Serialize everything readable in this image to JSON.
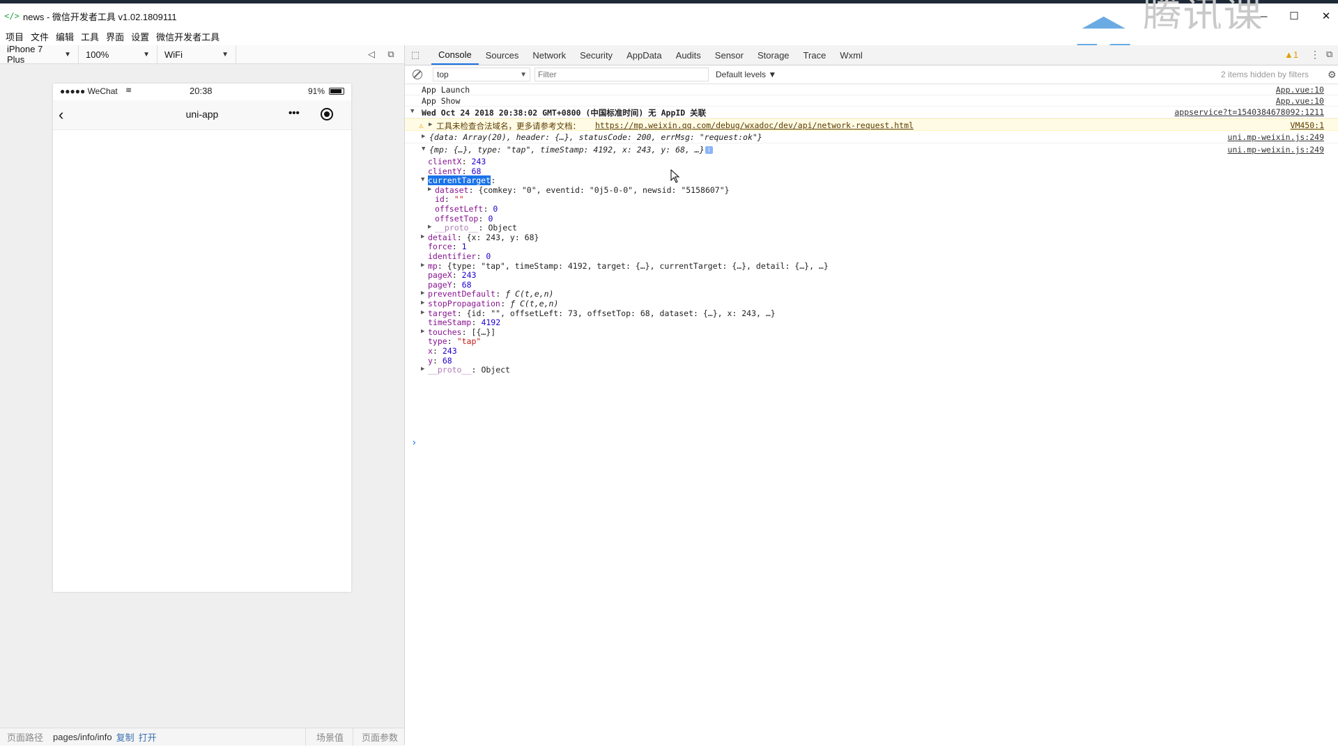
{
  "window": {
    "title": "news - 微信开发者工具 v1.02.1809111"
  },
  "menu": [
    "项目",
    "文件",
    "编辑",
    "工具",
    "界面",
    "设置",
    "微信开发者工具"
  ],
  "simulator": {
    "device": "iPhone 7 Plus",
    "zoom": "100%",
    "network": "WiFi",
    "status_carrier": "●●●●● WeChat",
    "status_time": "20:38",
    "status_battery": "91%",
    "battery_level": 0.91,
    "nav_title": "uni-app",
    "nav_more": "•••"
  },
  "bottom": {
    "path_label": "页面路径",
    "path": "pages/info/info",
    "copy": "复制",
    "open": "打开",
    "scene": "场景值",
    "params": "页面参数"
  },
  "devtools": {
    "tabs": [
      "Console",
      "Sources",
      "Network",
      "Security",
      "AppData",
      "Audits",
      "Sensor",
      "Storage",
      "Trace",
      "Wxml"
    ],
    "context": "top",
    "filter_placeholder": "Filter",
    "levels": "Default levels ▼",
    "hidden": "2 items hidden by filters"
  },
  "console": {
    "launch": "App Launch",
    "launch_src": "App.vue:10",
    "show": "App Show",
    "show_src": "App.vue:10",
    "date": "Wed Oct 24 2018 20:38:02 GMT+0800 (中国标准时间) 无 AppID 关联",
    "date_src": "appservice?t=1540384678092:1211",
    "warn_text": "工具未检查合法域名，更多请参考文档：",
    "warn_link": "https://mp.weixin.qq.com/debug/wxadoc/dev/api/network-request.html",
    "warn_src": "VM450:1",
    "resp_line": "{data: Array(20), header: {…}, statusCode: 200, errMsg: \"request:ok\"}",
    "resp_src": "uni.mp-weixin.js:249",
    "event_line": "{mp: {…}, type: \"tap\", timeStamp: 4192, x: 243, y: 68, …}",
    "event_src": "uni.mp-weixin.js:249",
    "props": [
      {
        "k": "clientX",
        "v": "243",
        "t": "num",
        "indent": 1,
        "exp": ""
      },
      {
        "k": "clientY",
        "v": "68",
        "t": "num",
        "indent": 1,
        "exp": ""
      },
      {
        "k": "currentTarget",
        "v": "",
        "t": "sel",
        "indent": 1,
        "exp": "open"
      },
      {
        "k": "dataset",
        "v": "{comkey: \"0\", eventid: \"0j5-0-0\", newsid: \"5158607\"}",
        "t": "obj",
        "indent": 2,
        "exp": "closed"
      },
      {
        "k": "id",
        "v": "\"\"",
        "t": "str",
        "indent": 2,
        "exp": ""
      },
      {
        "k": "offsetLeft",
        "v": "0",
        "t": "num",
        "indent": 2,
        "exp": ""
      },
      {
        "k": "offsetTop",
        "v": "0",
        "t": "num",
        "indent": 2,
        "exp": ""
      },
      {
        "k": "__proto__",
        "v": "Object",
        "t": "plain",
        "indent": 2,
        "exp": "closed"
      },
      {
        "k": "detail",
        "v": "{x: 243, y: 68}",
        "t": "obj",
        "indent": 1,
        "exp": "closed"
      },
      {
        "k": "force",
        "v": "1",
        "t": "num",
        "indent": 1,
        "exp": ""
      },
      {
        "k": "identifier",
        "v": "0",
        "t": "num",
        "indent": 1,
        "exp": ""
      },
      {
        "k": "mp",
        "v": "{type: \"tap\", timeStamp: 4192, target: {…}, currentTarget: {…}, detail: {…}, …}",
        "t": "obj",
        "indent": 1,
        "exp": "closed"
      },
      {
        "k": "pageX",
        "v": "243",
        "t": "num",
        "indent": 1,
        "exp": ""
      },
      {
        "k": "pageY",
        "v": "68",
        "t": "num",
        "indent": 1,
        "exp": ""
      },
      {
        "k": "preventDefault",
        "v": "ƒ C(t,e,n)",
        "t": "fn",
        "indent": 1,
        "exp": "closed"
      },
      {
        "k": "stopPropagation",
        "v": "ƒ C(t,e,n)",
        "t": "fn",
        "indent": 1,
        "exp": "closed"
      },
      {
        "k": "target",
        "v": "{id: \"\", offsetLeft: 73, offsetTop: 68, dataset: {…}, x: 243, …}",
        "t": "obj",
        "indent": 1,
        "exp": "closed"
      },
      {
        "k": "timeStamp",
        "v": "4192",
        "t": "num",
        "indent": 1,
        "exp": ""
      },
      {
        "k": "touches",
        "v": "[{…}]",
        "t": "obj",
        "indent": 1,
        "exp": "closed"
      },
      {
        "k": "type",
        "v": "\"tap\"",
        "t": "str",
        "indent": 1,
        "exp": ""
      },
      {
        "k": "x",
        "v": "243",
        "t": "num",
        "indent": 1,
        "exp": ""
      },
      {
        "k": "y",
        "v": "68",
        "t": "num",
        "indent": 1,
        "exp": ""
      },
      {
        "k": "__proto__",
        "v": "Object",
        "t": "plain",
        "indent": 1,
        "exp": "closed"
      }
    ],
    "prompt": "›"
  },
  "watermark": {
    "text": "腾讯课堂"
  }
}
